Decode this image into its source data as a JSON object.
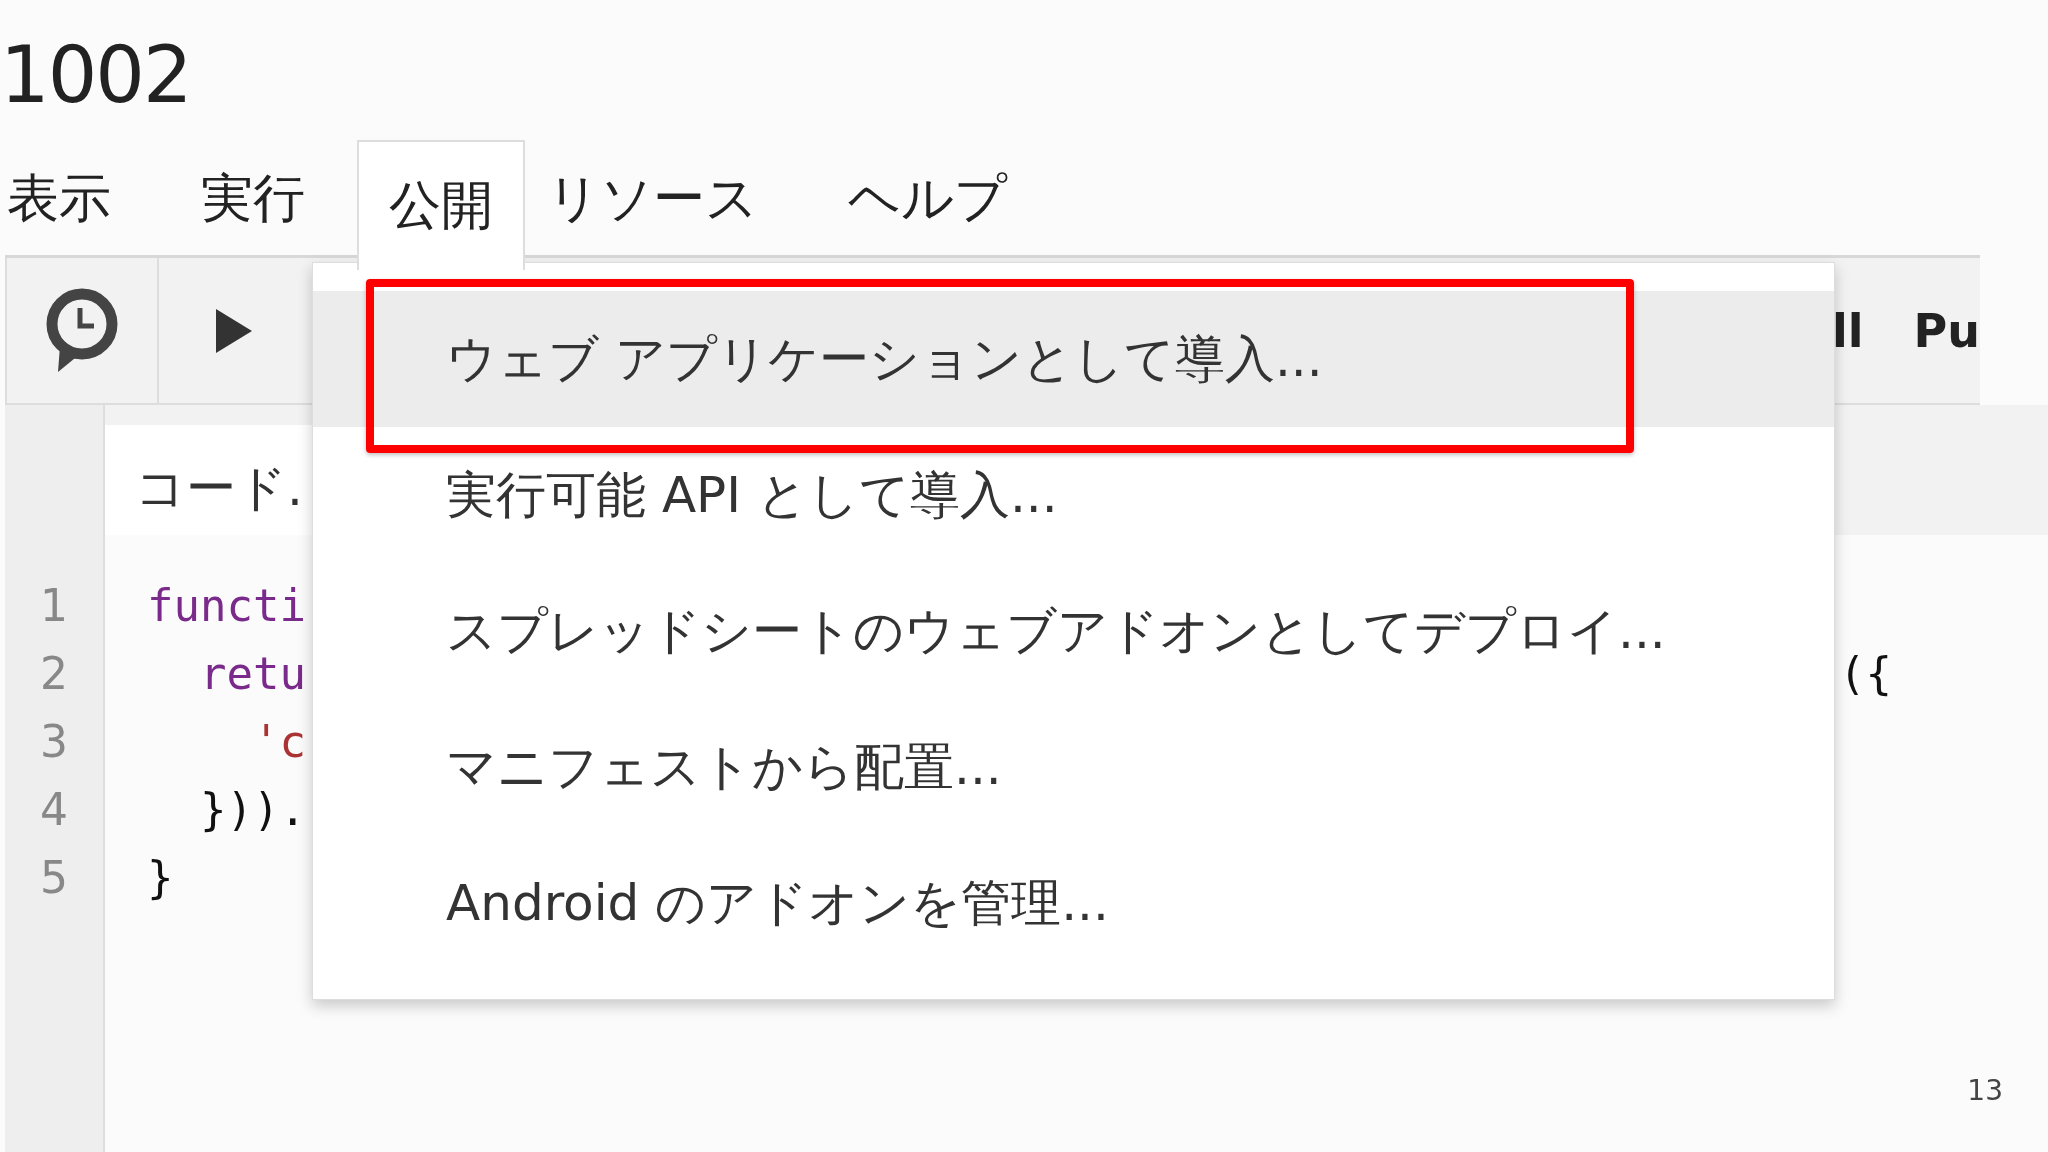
{
  "document_title": "1002",
  "menu_bar": [
    {
      "label": "表示",
      "selected": false
    },
    {
      "label": "実行",
      "selected": false
    },
    {
      "label": "公開",
      "selected": true
    },
    {
      "label": "リソース",
      "selected": false
    },
    {
      "label": "ヘルプ",
      "selected": false
    }
  ],
  "toolbar": {
    "labels": [
      "ll",
      "Pu"
    ]
  },
  "file_tab": {
    "label": "コード."
  },
  "code_lines": [
    {
      "number": "1",
      "text": "functi",
      "kind": "keyword"
    },
    {
      "number": "2",
      "text": "  retu",
      "kind": "keyword",
      "tail": "({"
    },
    {
      "number": "3",
      "text": "    'c",
      "kind": "string"
    },
    {
      "number": "4",
      "text": "  })).",
      "kind": "plain"
    },
    {
      "number": "5",
      "text": "}",
      "kind": "plain"
    }
  ],
  "dropdown": [
    {
      "label": "ウェブ アプリケーションとして導入...",
      "selected": true,
      "callout": true
    },
    {
      "label": "実行可能 API として導入...",
      "selected": false,
      "callout": false
    },
    {
      "label": "スプレッドシートのウェブアドオンとしてデプロイ...",
      "selected": false,
      "callout": false
    },
    {
      "label": "マニフェストから配置...",
      "selected": false,
      "callout": false
    },
    {
      "label": "Android のアドオンを管理...",
      "selected": false,
      "callout": false
    }
  ],
  "page_number": "13"
}
